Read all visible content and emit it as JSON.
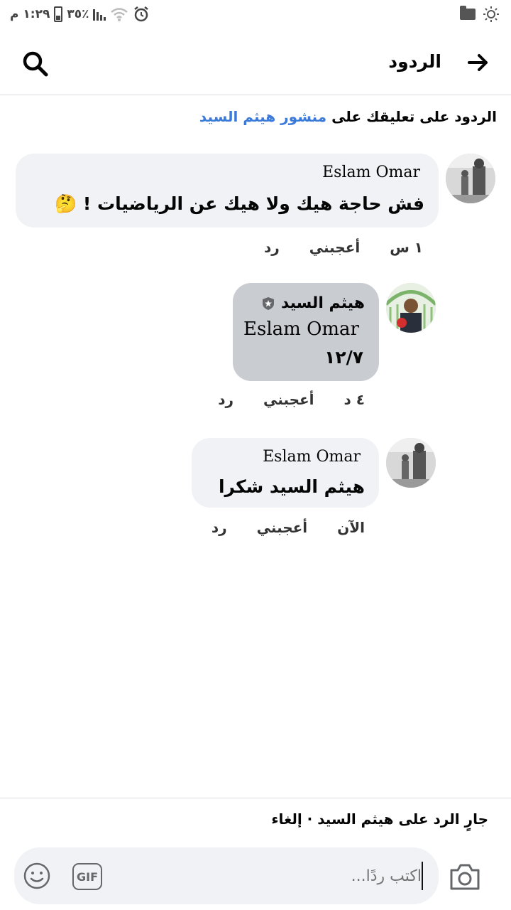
{
  "status_bar": {
    "time": "١:٢٩ م",
    "battery": "٪٣٥"
  },
  "header": {
    "title": "الردود",
    "back_icon": "arrow-right-icon",
    "search_icon": "search-icon"
  },
  "context": {
    "prefix": "الردود على تعليقك على ",
    "link": "منشور هيثم السيد"
  },
  "comments": [
    {
      "author": "Eslam Omar",
      "text": "فش حاجة هيك ولا هيك عن الرياضيات ! 🤔",
      "time": "١ س",
      "like": "أعجبني",
      "reply": "رد"
    },
    {
      "author": "هيثم السيد",
      "mention": "Eslam Omar",
      "text": "١٢/٧",
      "time": "٤ د",
      "like": "أعجبني",
      "reply": "رد"
    },
    {
      "author": "Eslam Omar",
      "text": "هيثم السيد شكرا",
      "time": "الآن",
      "like": "أعجبني",
      "reply": "رد"
    }
  ],
  "composer": {
    "replying_prefix": "جارٍ الرد على ",
    "replying_name": "هيثم السيد",
    "separator": " · ",
    "cancel": "إلغاء",
    "placeholder": "اكتب ردًا...",
    "gif_label": "GIF"
  }
}
